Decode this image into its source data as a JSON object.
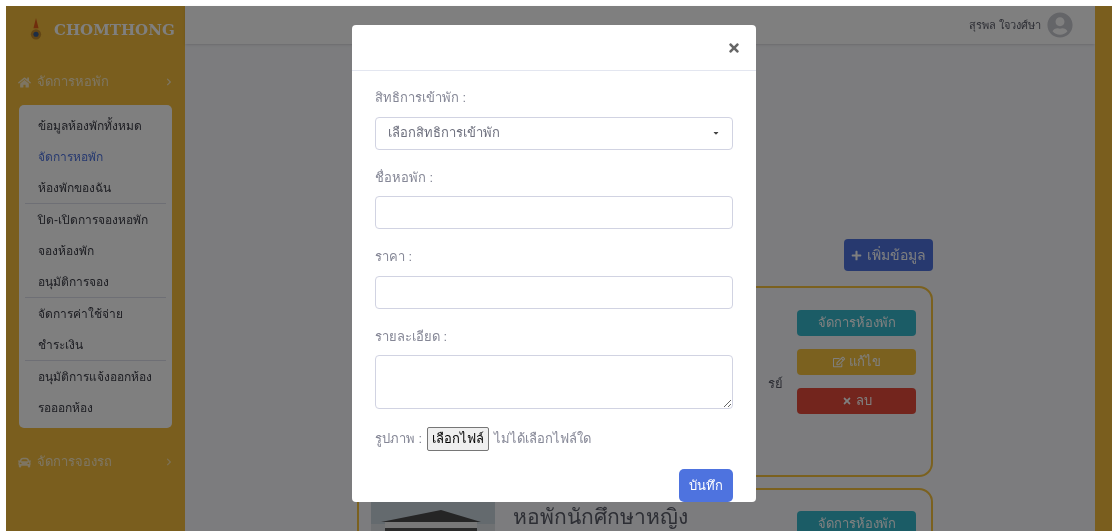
{
  "brand": {
    "name": "CHOMTHONG"
  },
  "sidebar": {
    "sections": [
      {
        "label": "จัดการหอพัก",
        "kind": "home",
        "expanded": true,
        "groups": [
          [
            {
              "label": "ข้อมูลห้องพักทั้งหมด",
              "selected": false
            },
            {
              "label": "จัดการหอพัก",
              "selected": true
            },
            {
              "label": "ห้องพักของฉัน",
              "selected": false
            }
          ],
          [
            {
              "label": "ปิด-เปิดการจองหอพัก",
              "selected": false
            },
            {
              "label": "จองห้องพัก",
              "selected": false
            },
            {
              "label": "อนุมัติการจอง",
              "selected": false
            }
          ],
          [
            {
              "label": "จัดการค่าใช้จ่าย",
              "selected": false
            },
            {
              "label": "ชำระเงิน",
              "selected": false
            }
          ],
          [
            {
              "label": "อนุมัติการแจ้งออกห้อง",
              "selected": false
            },
            {
              "label": "รอออกห้อง",
              "selected": false
            }
          ]
        ]
      },
      {
        "label": "จัดการจองรถ",
        "kind": "car",
        "expanded": false
      }
    ]
  },
  "topbar": {
    "user_name": "สุรพล ใจวงศ์ษา"
  },
  "add_button": "เพิ่มข้อมูล",
  "cards": [
    {
      "text_fragment": "รย์",
      "buttons": [
        {
          "kind": "manage",
          "label": "จัดการห้องพัก"
        },
        {
          "kind": "edit",
          "label": "แก้ไข"
        },
        {
          "kind": "delete",
          "label": "ลบ"
        }
      ]
    },
    {
      "title": "หอพักนักศึกษาหญิง",
      "picture": {
        "kind": "picture"
      },
      "buttons": [
        {
          "kind": "manage",
          "label": "จัดการห้องพัก"
        }
      ]
    }
  ],
  "modal": {
    "fields": [
      {
        "kind": "select",
        "label": "สิทธิการเข้าพัก :",
        "value": "เลือกสิทธิการเข้าพัก"
      },
      {
        "kind": "text",
        "label": "ชื่อหอพัก :"
      },
      {
        "kind": "text",
        "label": "ราคา :"
      },
      {
        "kind": "textarea",
        "label": "รายละเอียด :"
      },
      {
        "kind": "file",
        "label": "รูปภาพ :",
        "button": "เลือกไฟล์",
        "status": "ไม่ได้เลือกไฟล์ใด"
      }
    ],
    "save_button": "บันทึก"
  }
}
